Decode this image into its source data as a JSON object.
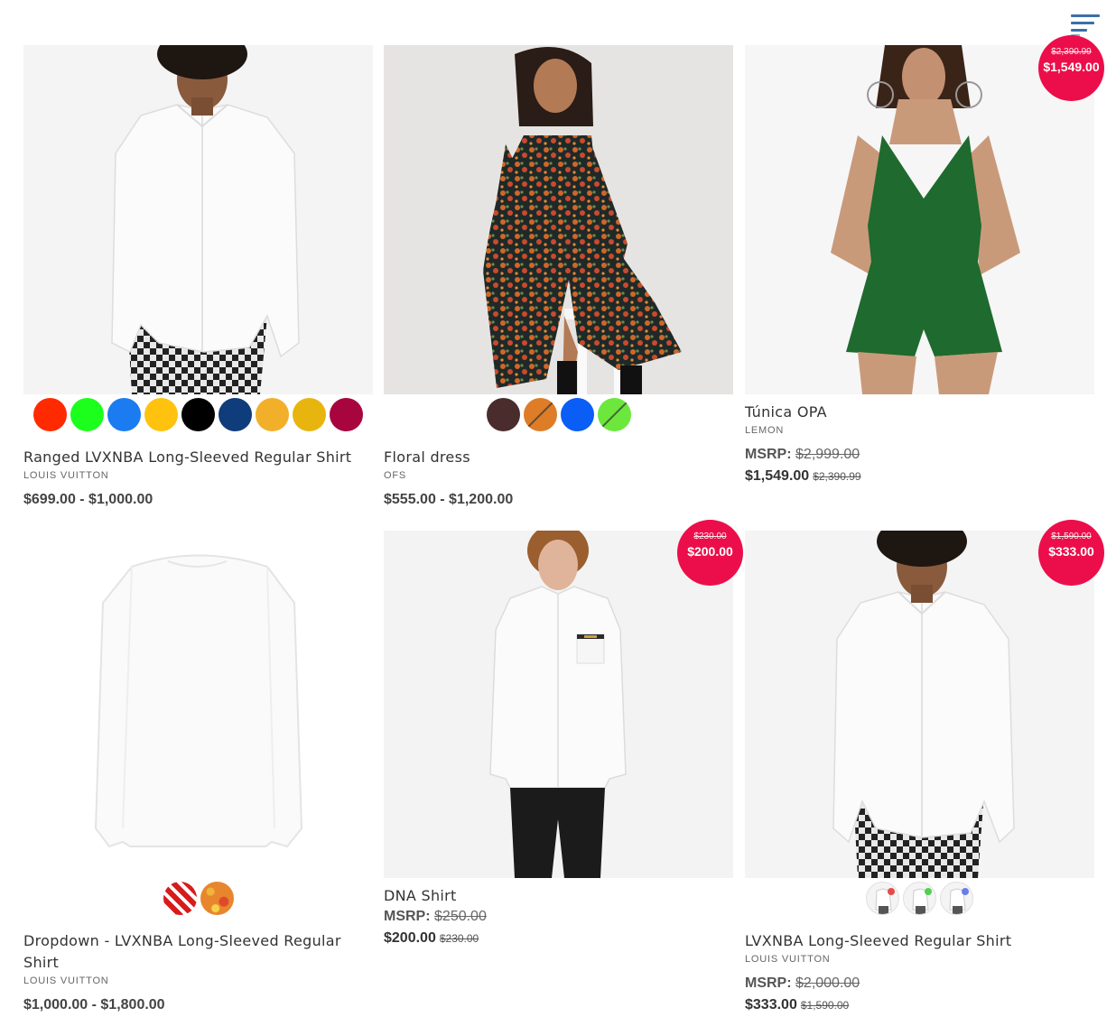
{
  "menu": {
    "icon": "hamburger-menu-icon"
  },
  "products": [
    {
      "title": "Ranged LVXNBA Long-Sleeved Regular Shirt",
      "brand": "LOUIS VUITTON",
      "price_range": "$699.00 - $1,000.00",
      "swatches": [
        "#ff2a00",
        "#1cff1c",
        "#1a7cf0",
        "#ffc20e",
        "#000000",
        "#0f3c7a",
        "#f2b02a",
        "#e8b50f",
        "#a8053e"
      ]
    },
    {
      "title": "Floral dress",
      "brand": "OFS",
      "price_range": "$555.00 - $1,200.00",
      "swatches": [
        "#4a2c2c",
        "#de7c28",
        "#0a5df5",
        "#6ce83c"
      ]
    },
    {
      "title": "Túnica OPA",
      "brand": "LEMON",
      "msrp_label": "MSRP:",
      "msrp_value": "$2,999.00",
      "price": "$1,549.00",
      "was_price": "$2,390.99",
      "badge": {
        "old": "$2,390.99",
        "new": "$1,549.00"
      }
    },
    {
      "title": "Dropdown - LVXNBA Long-Sleeved Regular Shirt",
      "brand": "LOUIS VUITTON",
      "price_range": "$1,000.00 - $1,800.00",
      "swatches": [
        "pattern-red-hearts",
        "pattern-orange-floral"
      ]
    },
    {
      "title": "DNA Shirt",
      "msrp_label": "MSRP:",
      "msrp_value": "$250.00",
      "price": "$200.00",
      "was_price": "$230.00",
      "badge": {
        "old": "$230.00",
        "new": "$200.00"
      }
    },
    {
      "title": "LVXNBA Long-Sleeved Regular Shirt",
      "brand": "LOUIS VUITTON",
      "msrp_label": "MSRP:",
      "msrp_value": "$2,000.00",
      "price": "$333.00",
      "was_price": "$1,590.00",
      "badge": {
        "old": "$1,590.00",
        "new": "$333.00"
      },
      "swatches": [
        "shirt-thumb-red",
        "shirt-thumb-green",
        "shirt-thumb-blue"
      ]
    }
  ]
}
